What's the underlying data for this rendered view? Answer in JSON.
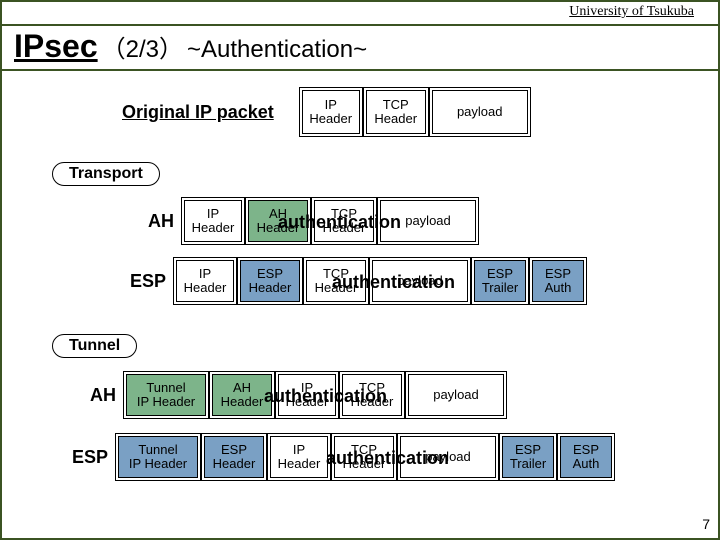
{
  "affiliation": "University of Tsukuba",
  "title": {
    "main": "IPsec",
    "paren": "（2/3）",
    "sub": "~Authentication~"
  },
  "labels": {
    "original": "Original  IP packet",
    "transport": "Transport",
    "tunnel": "Tunnel",
    "ah": "AH",
    "esp": "ESP",
    "authentication": "authentication"
  },
  "boxes": {
    "ip_header": "IP\nHeader",
    "tcp_header": "TCP\nHeader",
    "ah_header": "AH\nHeader",
    "esp_header": "ESP\nHeader",
    "tunnel_ip_header": "Tunnel\nIP Header",
    "payload": "payload",
    "esp_trailer": "ESP\nTrailer",
    "esp_auth": "ESP\nAuth"
  },
  "slide_number": "7"
}
